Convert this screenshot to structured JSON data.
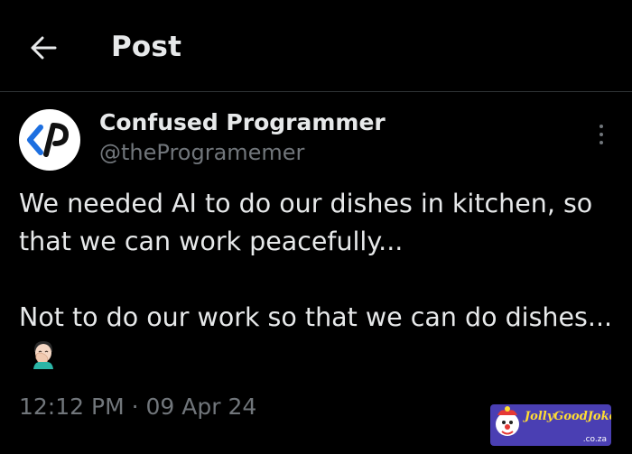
{
  "header": {
    "title": "Post",
    "back_icon": "arrow-left-icon"
  },
  "author": {
    "name": "Confused Programmer",
    "handle": "@theProgramemer",
    "avatar_icon": "code-brackets-logo"
  },
  "post": {
    "text": "We needed AI to do our dishes in kitchen, so that we can work peacefully...\n\nNot to do our work so that we can do dishes...",
    "emoji": "person-facepalming-emoji"
  },
  "timestamp": {
    "time": "12:12 PM",
    "separator": "·",
    "date": "09 Apr 24"
  },
  "watermark": {
    "brand": "JollyGoodJokes",
    "domain": ".co.za"
  },
  "colors": {
    "background": "#000000",
    "primary_text": "#e7e9ea",
    "secondary_text": "#71767b",
    "divider": "#2f3336"
  }
}
